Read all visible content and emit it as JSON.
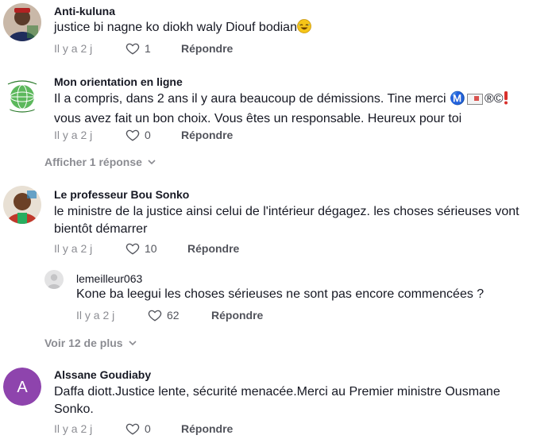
{
  "comments": [
    {
      "username": "Anti-kuluna",
      "text": "justice bi nagne ko diokh waly Diouf bodian",
      "emoji": "🤣",
      "time": "Il y a 2 j",
      "likes": "1",
      "reply_label": "Répondre"
    },
    {
      "username": "Mon orientation en ligne",
      "text_line1": "Il a compris, dans 2 ans il y aura beaucoup de démissions. Tine merci Ⓜ️",
      "text_symbols": "®©",
      "text_line2": "vous avez fait un bon choix. Vous êtes un responsable. Heureux pour toi",
      "time": "Il y a 2 j",
      "likes": "0",
      "reply_label": "Répondre",
      "replies_toggle": "Afficher 1 réponse"
    },
    {
      "username": "Le professeur Bou Sonko",
      "text": "le ministre de la justice ainsi celui de l'intérieur dégagez. les choses sérieuses vont bientôt démarrer",
      "time": "Il y a 2 j",
      "likes": "10",
      "reply_label": "Répondre",
      "reply": {
        "username": "lemeilleur063",
        "text": "Kone ba leegui les choses sérieuses ne sont pas encore commencées ?",
        "time": "Il y a 2 j",
        "likes": "62",
        "reply_label": "Répondre"
      },
      "more_toggle": "Voir 12 de plus"
    },
    {
      "username": "Alssane Goudiaby",
      "avatar_letter": "A",
      "avatar_color": "#8e44ad",
      "text": "Daffa diott.Justice lente, sécurité menacée.Merci au Premier ministre Ousmane Sonko.",
      "time": "Il y a 2 j",
      "likes": "0",
      "reply_label": "Répondre"
    }
  ]
}
